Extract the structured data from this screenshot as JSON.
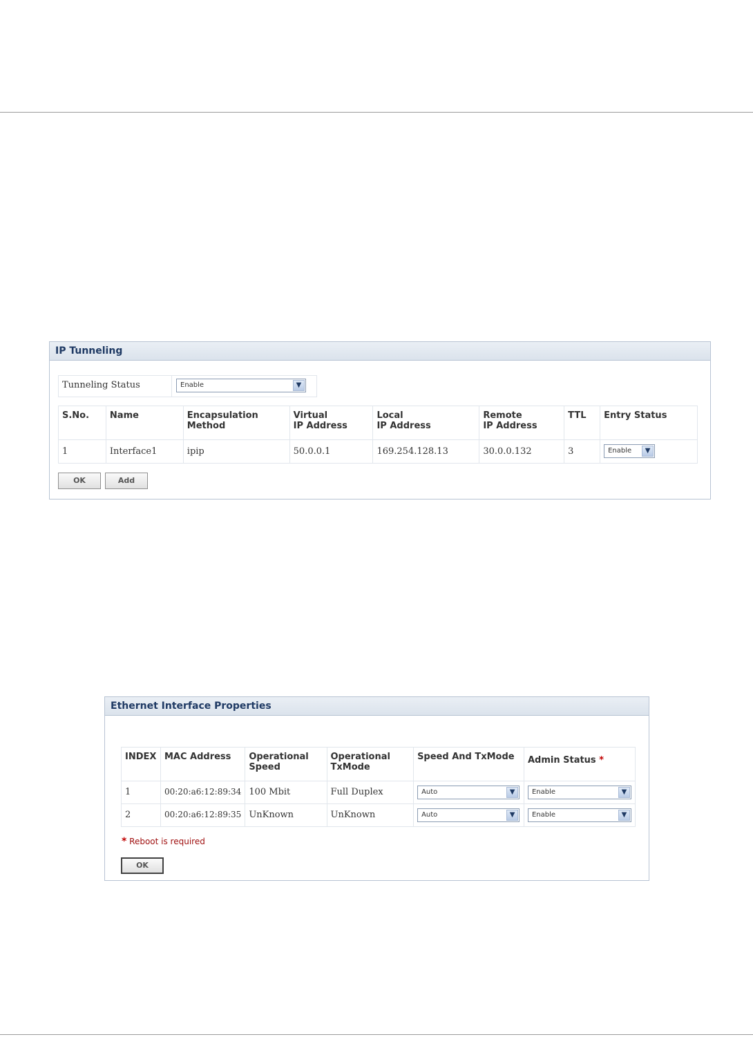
{
  "ip_tunneling": {
    "title": "IP Tunneling",
    "tunneling_status_label": "Tunneling Status",
    "tunneling_status_value": "Enable",
    "headers": {
      "sno": "S.No.",
      "name": "Name",
      "encap_1": "Encapsulation",
      "encap_2": "Method",
      "virtual_1": "Virtual",
      "virtual_2": "IP Address",
      "local_1": "Local",
      "local_2": "IP Address",
      "remote_1": "Remote",
      "remote_2": "IP Address",
      "ttl": "TTL",
      "entry_status": "Entry Status"
    },
    "rows": [
      {
        "sno": "1",
        "name": "Interface1",
        "encapsulation": "ipip",
        "virtual_ip": "50.0.0.1",
        "local_ip": "169.254.128.13",
        "remote_ip": "30.0.0.132",
        "ttl": "3",
        "entry_status": "Enable"
      }
    ],
    "ok_label": "OK",
    "add_label": "Add"
  },
  "ethernet": {
    "title": "Ethernet Interface Properties",
    "headers": {
      "index": "INDEX",
      "mac": "MAC Address",
      "op_speed_1": "Operational",
      "op_speed_2": "Speed",
      "op_tx_1": "Operational",
      "op_tx_2": "TxMode",
      "speed_txmode": "Speed And TxMode",
      "admin_status": "Admin Status",
      "required_mark": "*"
    },
    "rows": [
      {
        "index": "1",
        "mac": "00:20:a6:12:89:34",
        "op_speed": "100 Mbit",
        "op_txmode": "Full Duplex",
        "speed_txmode": "Auto",
        "admin_status": "Enable"
      },
      {
        "index": "2",
        "mac": "00:20:a6:12:89:35",
        "op_speed": "UnKnown",
        "op_txmode": "UnKnown",
        "speed_txmode": "Auto",
        "admin_status": "Enable"
      }
    ],
    "reboot_note_mark": "*",
    "reboot_note": "Reboot is required",
    "ok_label": "OK"
  },
  "icons": {
    "dropdown": "chevron-down-icon"
  },
  "colors": {
    "title_text": "#1f3a64",
    "panel_border": "#b7c3d3",
    "required_mark": "#c00000"
  }
}
